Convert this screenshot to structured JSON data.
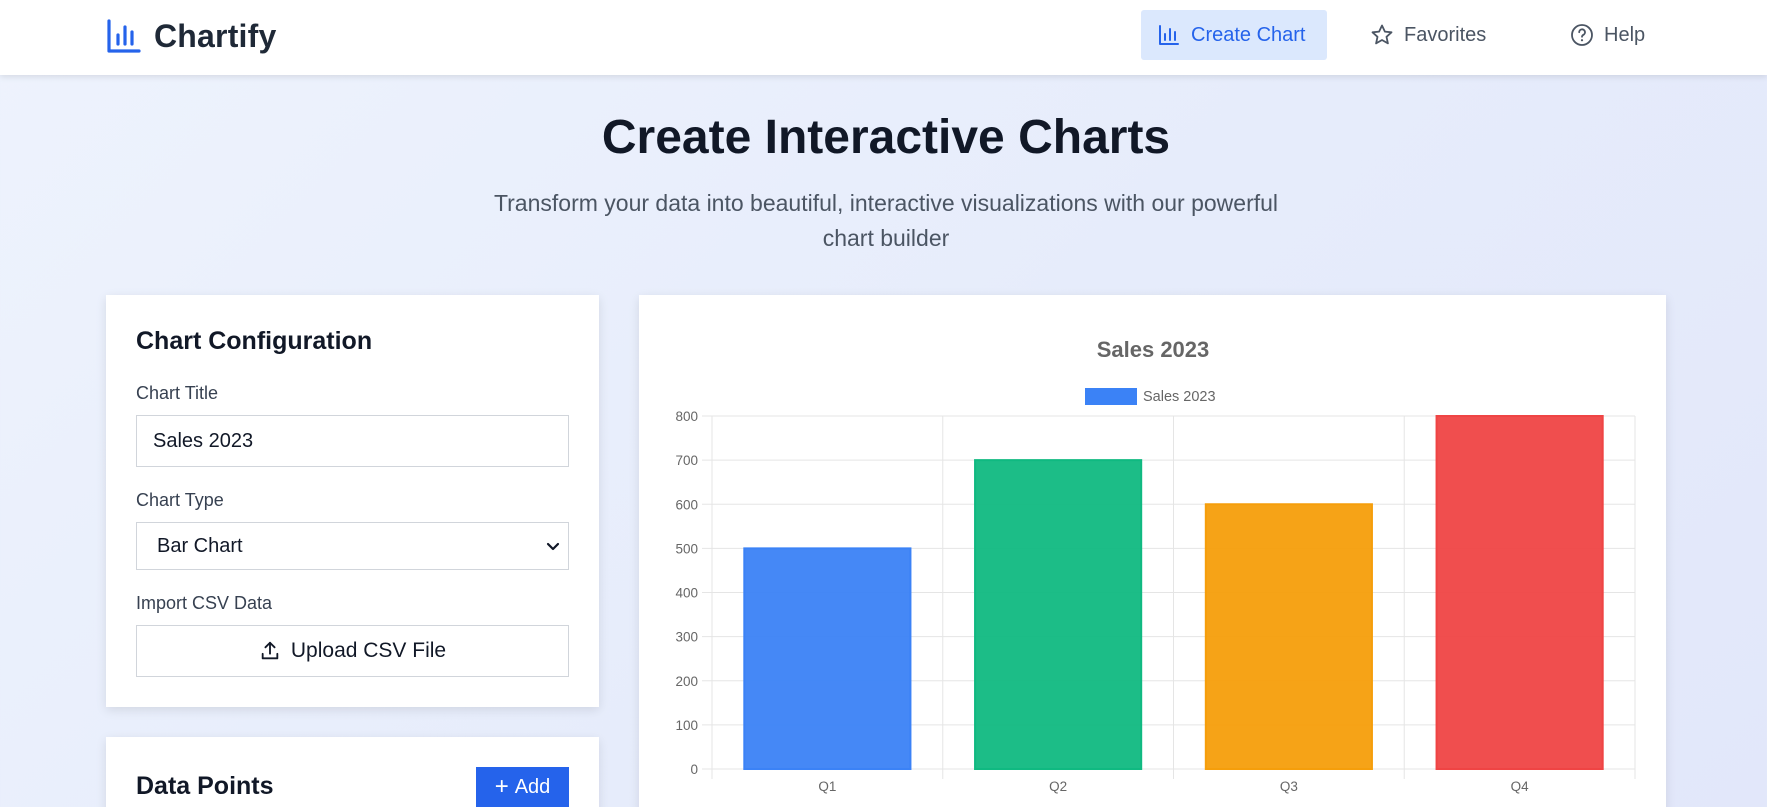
{
  "brand": {
    "name": "Chartify",
    "icon": "bar-chart-icon",
    "accent": "#2563eb"
  },
  "nav": {
    "items": [
      {
        "label": "Create Chart",
        "icon": "bar-chart-icon",
        "active": true
      },
      {
        "label": "Favorites",
        "icon": "star-icon",
        "active": false
      },
      {
        "label": "Help",
        "icon": "help-circle-icon",
        "active": false
      }
    ]
  },
  "hero": {
    "title": "Create Interactive Charts",
    "subtitle": "Transform your data into beautiful, interactive visualizations with our powerful chart builder"
  },
  "config": {
    "title": "Chart Configuration",
    "chart_title_label": "Chart Title",
    "chart_title_value": "Sales 2023",
    "chart_type_label": "Chart Type",
    "chart_type_value": "Bar Chart",
    "csv_label": "Import CSV Data",
    "upload_label": "Upload CSV File"
  },
  "data_points": {
    "title": "Data Points",
    "add_label": "Add"
  },
  "chart_data": {
    "type": "bar",
    "title": "Sales 2023",
    "categories": [
      "Q1",
      "Q2",
      "Q3",
      "Q4"
    ],
    "series": [
      {
        "name": "Sales 2023",
        "values": [
          500,
          700,
          600,
          800
        ]
      }
    ],
    "bar_colors": [
      "#3b82f6",
      "#10b981",
      "#f59e0b",
      "#ef4444"
    ],
    "legend_color": "#3b82f6",
    "ylim": [
      0,
      800
    ],
    "yticks": [
      0,
      100,
      200,
      300,
      400,
      500,
      600,
      700,
      800
    ],
    "grid": true,
    "legend_position": "top"
  }
}
